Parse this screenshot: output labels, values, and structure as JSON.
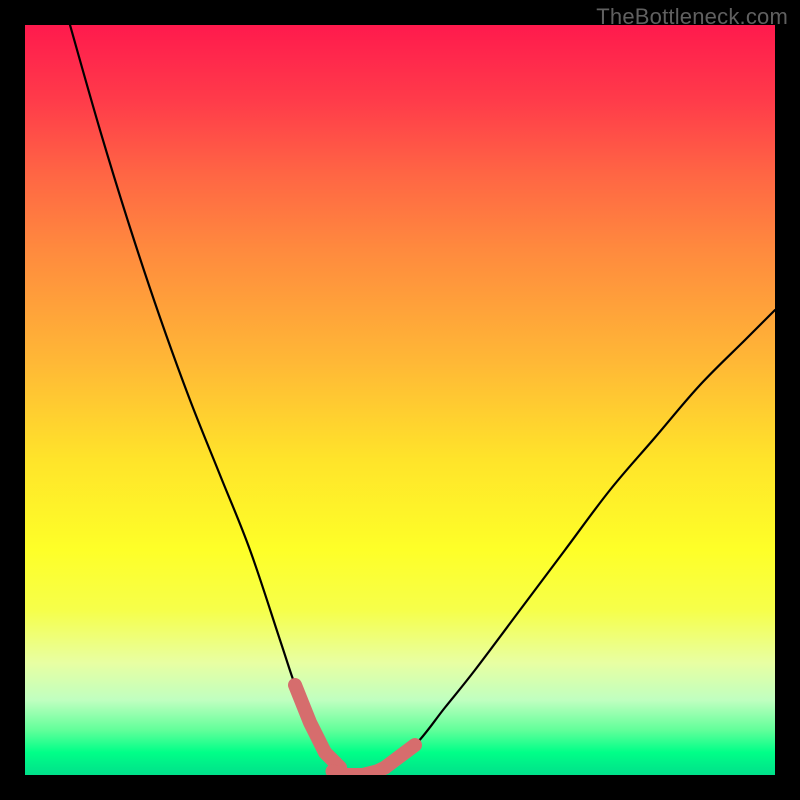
{
  "watermark": "TheBottleneck.com",
  "chart_data": {
    "type": "line",
    "title": "",
    "xlabel": "",
    "ylabel": "",
    "xlim": [
      0,
      100
    ],
    "ylim": [
      0,
      100
    ],
    "series": [
      {
        "name": "bottleneck-curve",
        "x": [
          6,
          10,
          14,
          18,
          22,
          26,
          30,
          34,
          36,
          38,
          40,
          42,
          44,
          46,
          48,
          52,
          56,
          60,
          66,
          72,
          78,
          84,
          90,
          96,
          100
        ],
        "y": [
          100,
          86,
          73,
          61,
          50,
          40,
          30,
          18,
          12,
          7,
          3,
          1,
          0,
          0,
          1,
          4,
          9,
          14,
          22,
          30,
          38,
          45,
          52,
          58,
          62
        ]
      }
    ],
    "highlight_segments": [
      {
        "name": "left-ascent-marker",
        "x": [
          36,
          38,
          40,
          42
        ],
        "y": [
          12,
          7,
          3,
          1
        ]
      },
      {
        "name": "right-ascent-marker",
        "x": [
          46,
          48,
          50,
          52
        ],
        "y": [
          0,
          1,
          2.5,
          4
        ]
      },
      {
        "name": "valley-floor-marker",
        "x": [
          41,
          43,
          45,
          47
        ],
        "y": [
          0.5,
          0,
          0,
          0.5
        ]
      }
    ],
    "colors": {
      "curve": "#000000",
      "highlight": "#d66d6d",
      "gradient_top": "#ff1a4d",
      "gradient_bottom": "#00e08a"
    }
  }
}
